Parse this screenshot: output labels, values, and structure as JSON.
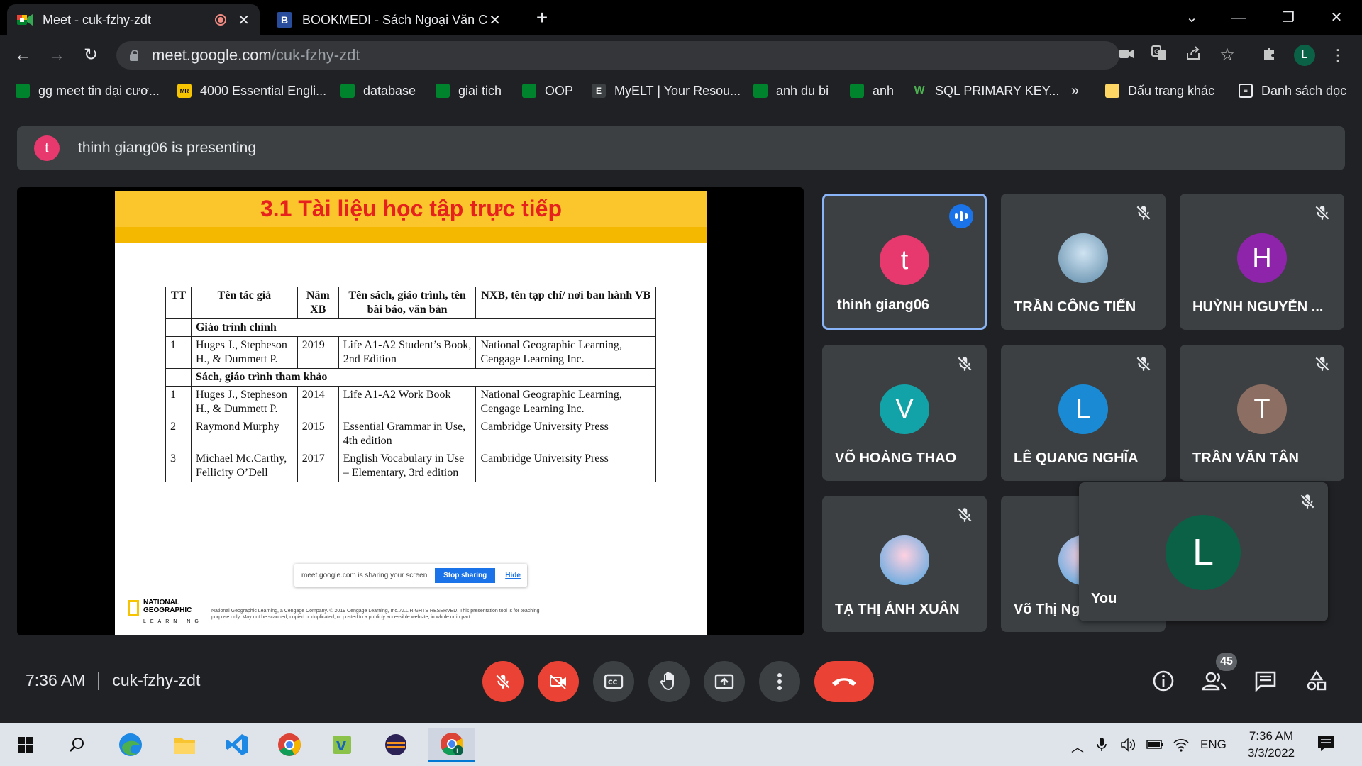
{
  "browser": {
    "tabs": [
      {
        "title": "Meet - cuk-fzhy-zdt",
        "active": true,
        "recording": true
      },
      {
        "title": "BOOKMEDI - Sách Ngoại Văn Chí",
        "active": false
      }
    ],
    "new_tab": "+",
    "url_host": "meet.google.com",
    "url_path": "/cuk-fzhy-zdt",
    "profile_initial": "L",
    "bookmarks": [
      "gg meet tin đại cươ...",
      "4000 Essential Engli...",
      "database",
      "giai tich",
      "OOP",
      "MyELT | Your Resou...",
      "anh du bi",
      "anh",
      "SQL PRIMARY KEY..."
    ],
    "bookmarks_overflow": "»",
    "other_bookmarks": "Dấu trang khác",
    "reading_list": "Danh sách đọc"
  },
  "meet": {
    "presenter_initial": "t",
    "presenting_text": "thinh giang06 is presenting",
    "slide": {
      "title": "3.1 Tài liệu học tập trực tiếp",
      "headers": [
        "TT",
        "Tên tác giả",
        "Năm XB",
        "Tên sách, giáo trình, tên bài báo, văn bản",
        "NXB, tên tạp chí/ nơi ban hành VB"
      ],
      "section1": "Giáo trình chính",
      "row1": [
        "1",
        "Huges J., Stepheson H., & Dummett P.",
        "2019",
        "Life A1-A2 Student’s Book, 2nd Edition",
        "National Geographic Learning, Cengage Learning Inc."
      ],
      "section2": "Sách, giáo trình tham khảo",
      "row2": [
        "1",
        "Huges J., Stepheson H., & Dummett P.",
        "2014",
        "Life A1-A2 Work Book",
        "National Geographic Learning, Cengage Learning Inc."
      ],
      "row3": [
        "2",
        "Raymond Murphy",
        "2015",
        "Essential Grammar in Use, 4th edition",
        "Cambridge University Press"
      ],
      "row4": [
        "3",
        "Michael Mc.Carthy, Fellicity O’Dell",
        "2017",
        "English Vocabulary in Use – Elementary, 3rd edition",
        "Cambridge University Press"
      ],
      "share_text": "meet.google.com is sharing your screen.",
      "stop_sharing": "Stop sharing",
      "hide": "Hide",
      "logo_line1": "NATIONAL",
      "logo_line2": "GEOGRAPHIC",
      "logo_line3": "LEARNING",
      "footer": "National Geographic Learning, a Cengage Company. © 2019 Cengage Learning, Inc. ALL RIGHTS RESERVED. This presentation tool is for teaching purpose only. May not be scanned, copied or duplicated, or posted to a publicly accessible website, in whole or in part."
    },
    "participants": [
      {
        "initial": "t",
        "name": "thinh giang06",
        "color": "#e8396e",
        "speaking": true
      },
      {
        "initial": "",
        "name": "TRẦN CÔNG TIẾN",
        "color": "photo",
        "speaking": false
      },
      {
        "initial": "H",
        "name": "HUỲNH NGUYỄN ...",
        "color": "#8e24aa",
        "speaking": false
      },
      {
        "initial": "V",
        "name": "VÕ HOÀNG THAO",
        "color": "#12a3a8",
        "speaking": false
      },
      {
        "initial": "L",
        "name": "LÊ QUANG NGHĨA",
        "color": "#1a8ad4",
        "speaking": false
      },
      {
        "initial": "T",
        "name": "TRẦN VĂN TÂN",
        "color": "#8d6e63",
        "speaking": false
      },
      {
        "initial": "",
        "name": "TẠ THỊ ÁNH XUÂN",
        "color": "cartoon",
        "speaking": false
      },
      {
        "initial": "",
        "name": "Võ Thị Ng",
        "color": "cartoon",
        "speaking": false
      }
    ],
    "self": {
      "initial": "L",
      "name": "You",
      "color": "#0b6146"
    },
    "time": "7:36 AM",
    "meeting_code": "cuk-fzhy-zdt",
    "participant_count": "45"
  },
  "taskbar": {
    "language": "ENG",
    "time": "7:36 AM",
    "date": "3/3/2022"
  }
}
